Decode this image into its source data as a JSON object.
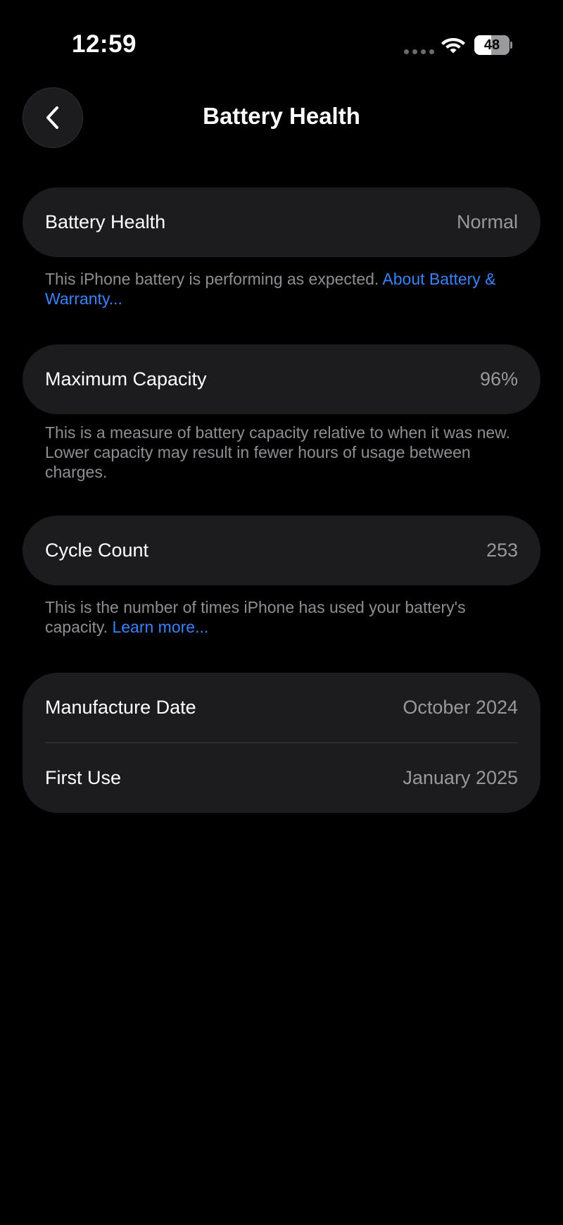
{
  "status_bar": {
    "time": "12:59",
    "battery_level": "48",
    "battery_fraction": 0.48,
    "icons": [
      "cellular-signal-icon",
      "wifi-icon",
      "battery-icon"
    ]
  },
  "nav": {
    "back_icon": "chevron-left-icon",
    "title": "Battery Health"
  },
  "sections": {
    "health": {
      "label": "Battery Health",
      "value": "Normal",
      "footnote_text": "This iPhone battery is performing as expected. ",
      "footnote_link": "About Battery & Warranty..."
    },
    "capacity": {
      "label": "Maximum Capacity",
      "value": "96%",
      "footnote_text": "This is a measure of battery capacity relative to when it was new. Lower capacity may result in fewer hours of usage between charges."
    },
    "cycle": {
      "label": "Cycle Count",
      "value": "253",
      "footnote_text": "This is the number of times iPhone has used your battery's capacity. ",
      "footnote_link": "Learn more..."
    },
    "dates": {
      "manufacture_label": "Manufacture Date",
      "manufacture_value": "October 2024",
      "first_use_label": "First Use",
      "first_use_value": "January 2025"
    }
  },
  "colors": {
    "background": "#000000",
    "card": "#1c1c1e",
    "secondary_text": "#98989d",
    "link": "#3a82f7"
  }
}
